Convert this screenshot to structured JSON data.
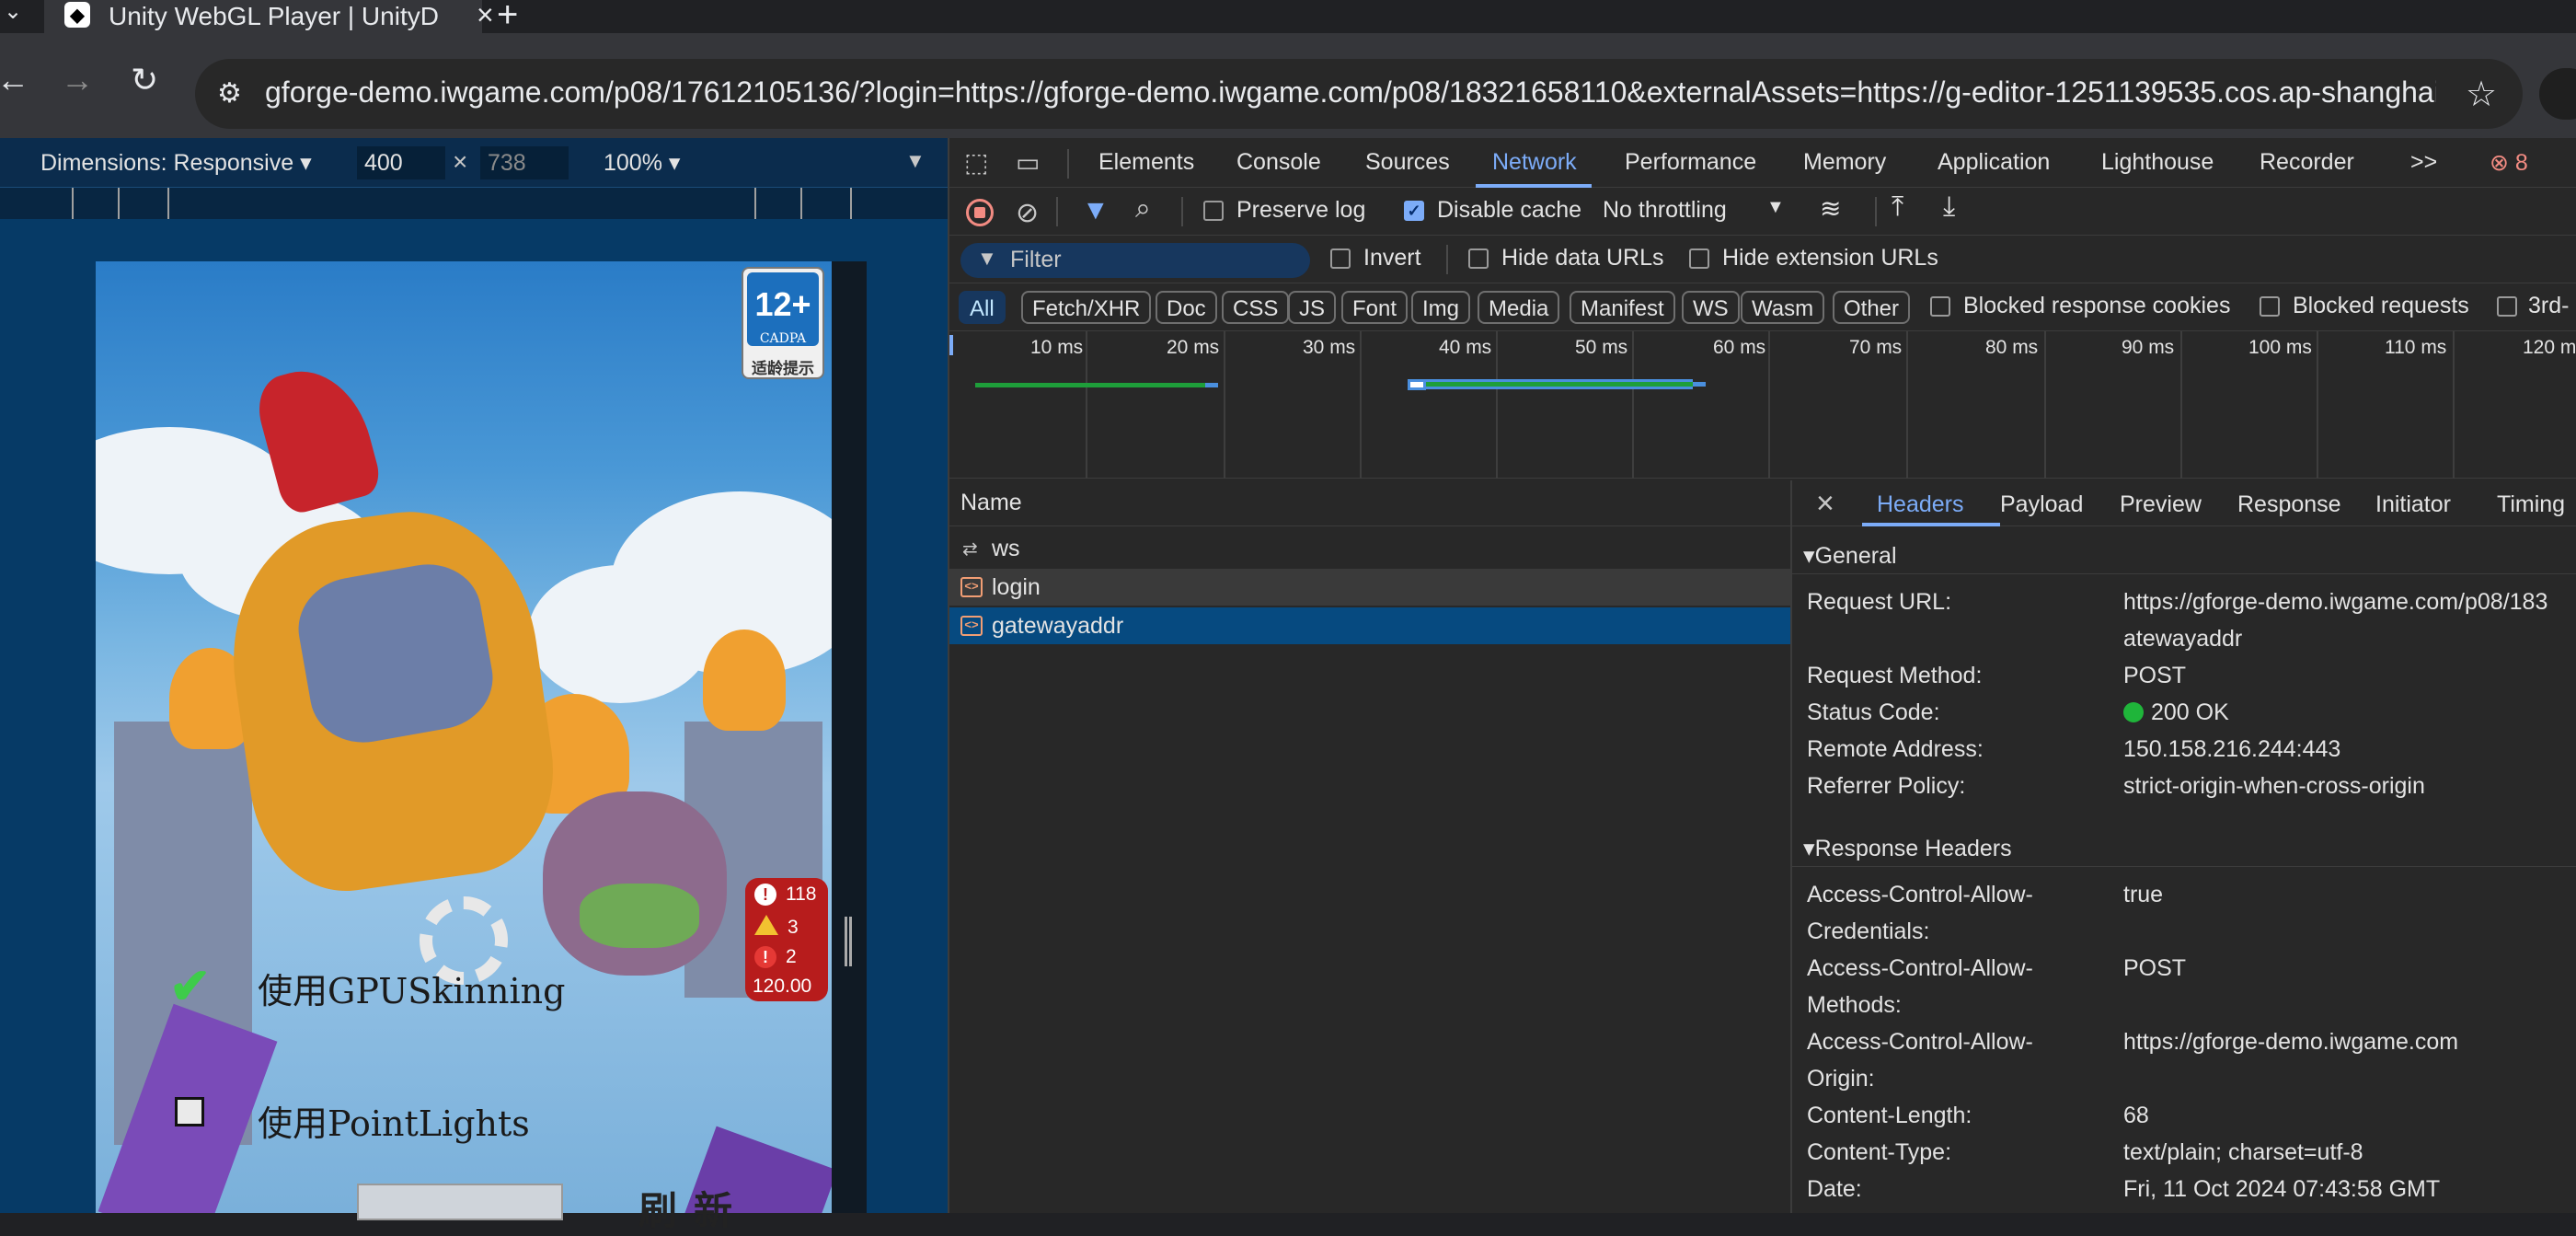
{
  "browser": {
    "tab_title": "Unity WebGL Player | UnityD",
    "tab_icon": "unity-icon",
    "url": "gforge-demo.iwgame.com/p08/17612105136/?login=https://gforge-demo.iwgame.com/p08/18321658110&externalAssets=https://g-editor-1251139535.cos.ap-shanghai.my..."
  },
  "device_toolbar": {
    "dimensions_label": "Dimensions: Responsive ▾",
    "width": "400",
    "times": "×",
    "height": "738",
    "zoom": "100% ▾"
  },
  "game": {
    "rating_num": "12+",
    "rating_org": "CADPA",
    "rating_tip": "适龄提示",
    "option_gpu": "使用GPUSkinning",
    "option_lights": "使用PointLights",
    "refresh_label": "刷新",
    "stats": {
      "info": "118",
      "warn": "3",
      "error": "2",
      "fps": "120.00"
    }
  },
  "devtools": {
    "tabs": [
      "Elements",
      "Console",
      "Sources",
      "Network",
      "Performance",
      "Memory",
      "Application",
      "Lighthouse",
      "Recorder"
    ],
    "more": ">>",
    "error_count": "8",
    "network_toolbar": {
      "preserve_log": "Preserve log",
      "disable_cache": "Disable cache",
      "throttling": "No throttling"
    },
    "filter": {
      "placeholder": "Filter",
      "invert": "Invert",
      "hide_data": "Hide data URLs",
      "hide_ext": "Hide extension URLs"
    },
    "chips": [
      "All",
      "Fetch/XHR",
      "Doc",
      "CSS",
      "JS",
      "Font",
      "Img",
      "Media",
      "Manifest",
      "WS",
      "Wasm",
      "Other"
    ],
    "blocked_cookies": "Blocked response cookies",
    "blocked_requests": "Blocked requests",
    "third_party": "3rd-",
    "timeline_labels": [
      "10 ms",
      "20 ms",
      "30 ms",
      "40 ms",
      "50 ms",
      "60 ms",
      "70 ms",
      "80 ms",
      "90 ms",
      "100 ms",
      "110 ms",
      "120 m"
    ],
    "list_header": "Name",
    "requests": [
      {
        "name": "ws",
        "type": "ws"
      },
      {
        "name": "login",
        "type": "doc"
      },
      {
        "name": "gatewayaddr",
        "type": "doc"
      }
    ],
    "detail_tabs": [
      "Headers",
      "Payload",
      "Preview",
      "Response",
      "Initiator",
      "Timing"
    ],
    "general": {
      "title": "General",
      "rows": [
        {
          "k": "Request URL:",
          "v": "https://gforge-demo.iwgame.com/p08/183"
        },
        {
          "k": "",
          "v": "atewayaddr"
        },
        {
          "k": "Request Method:",
          "v": "POST"
        },
        {
          "k": "Status Code:",
          "v": "200 OK"
        },
        {
          "k": "Remote Address:",
          "v": "150.158.216.244:443"
        },
        {
          "k": "Referrer Policy:",
          "v": "strict-origin-when-cross-origin"
        }
      ]
    },
    "response_headers": {
      "title": "Response Headers",
      "rows": [
        {
          "k": "Access-Control-Allow-",
          "v": "true"
        },
        {
          "k": "Credentials:",
          "v": ""
        },
        {
          "k": "Access-Control-Allow-",
          "v": "POST"
        },
        {
          "k": "Methods:",
          "v": ""
        },
        {
          "k": "Access-Control-Allow-",
          "v": "https://gforge-demo.iwgame.com"
        },
        {
          "k": "Origin:",
          "v": ""
        },
        {
          "k": "Content-Length:",
          "v": "68"
        },
        {
          "k": "Content-Type:",
          "v": "text/plain; charset=utf-8"
        },
        {
          "k": "Date:",
          "v": "Fri, 11 Oct 2024 07:43:58 GMT"
        }
      ]
    }
  }
}
